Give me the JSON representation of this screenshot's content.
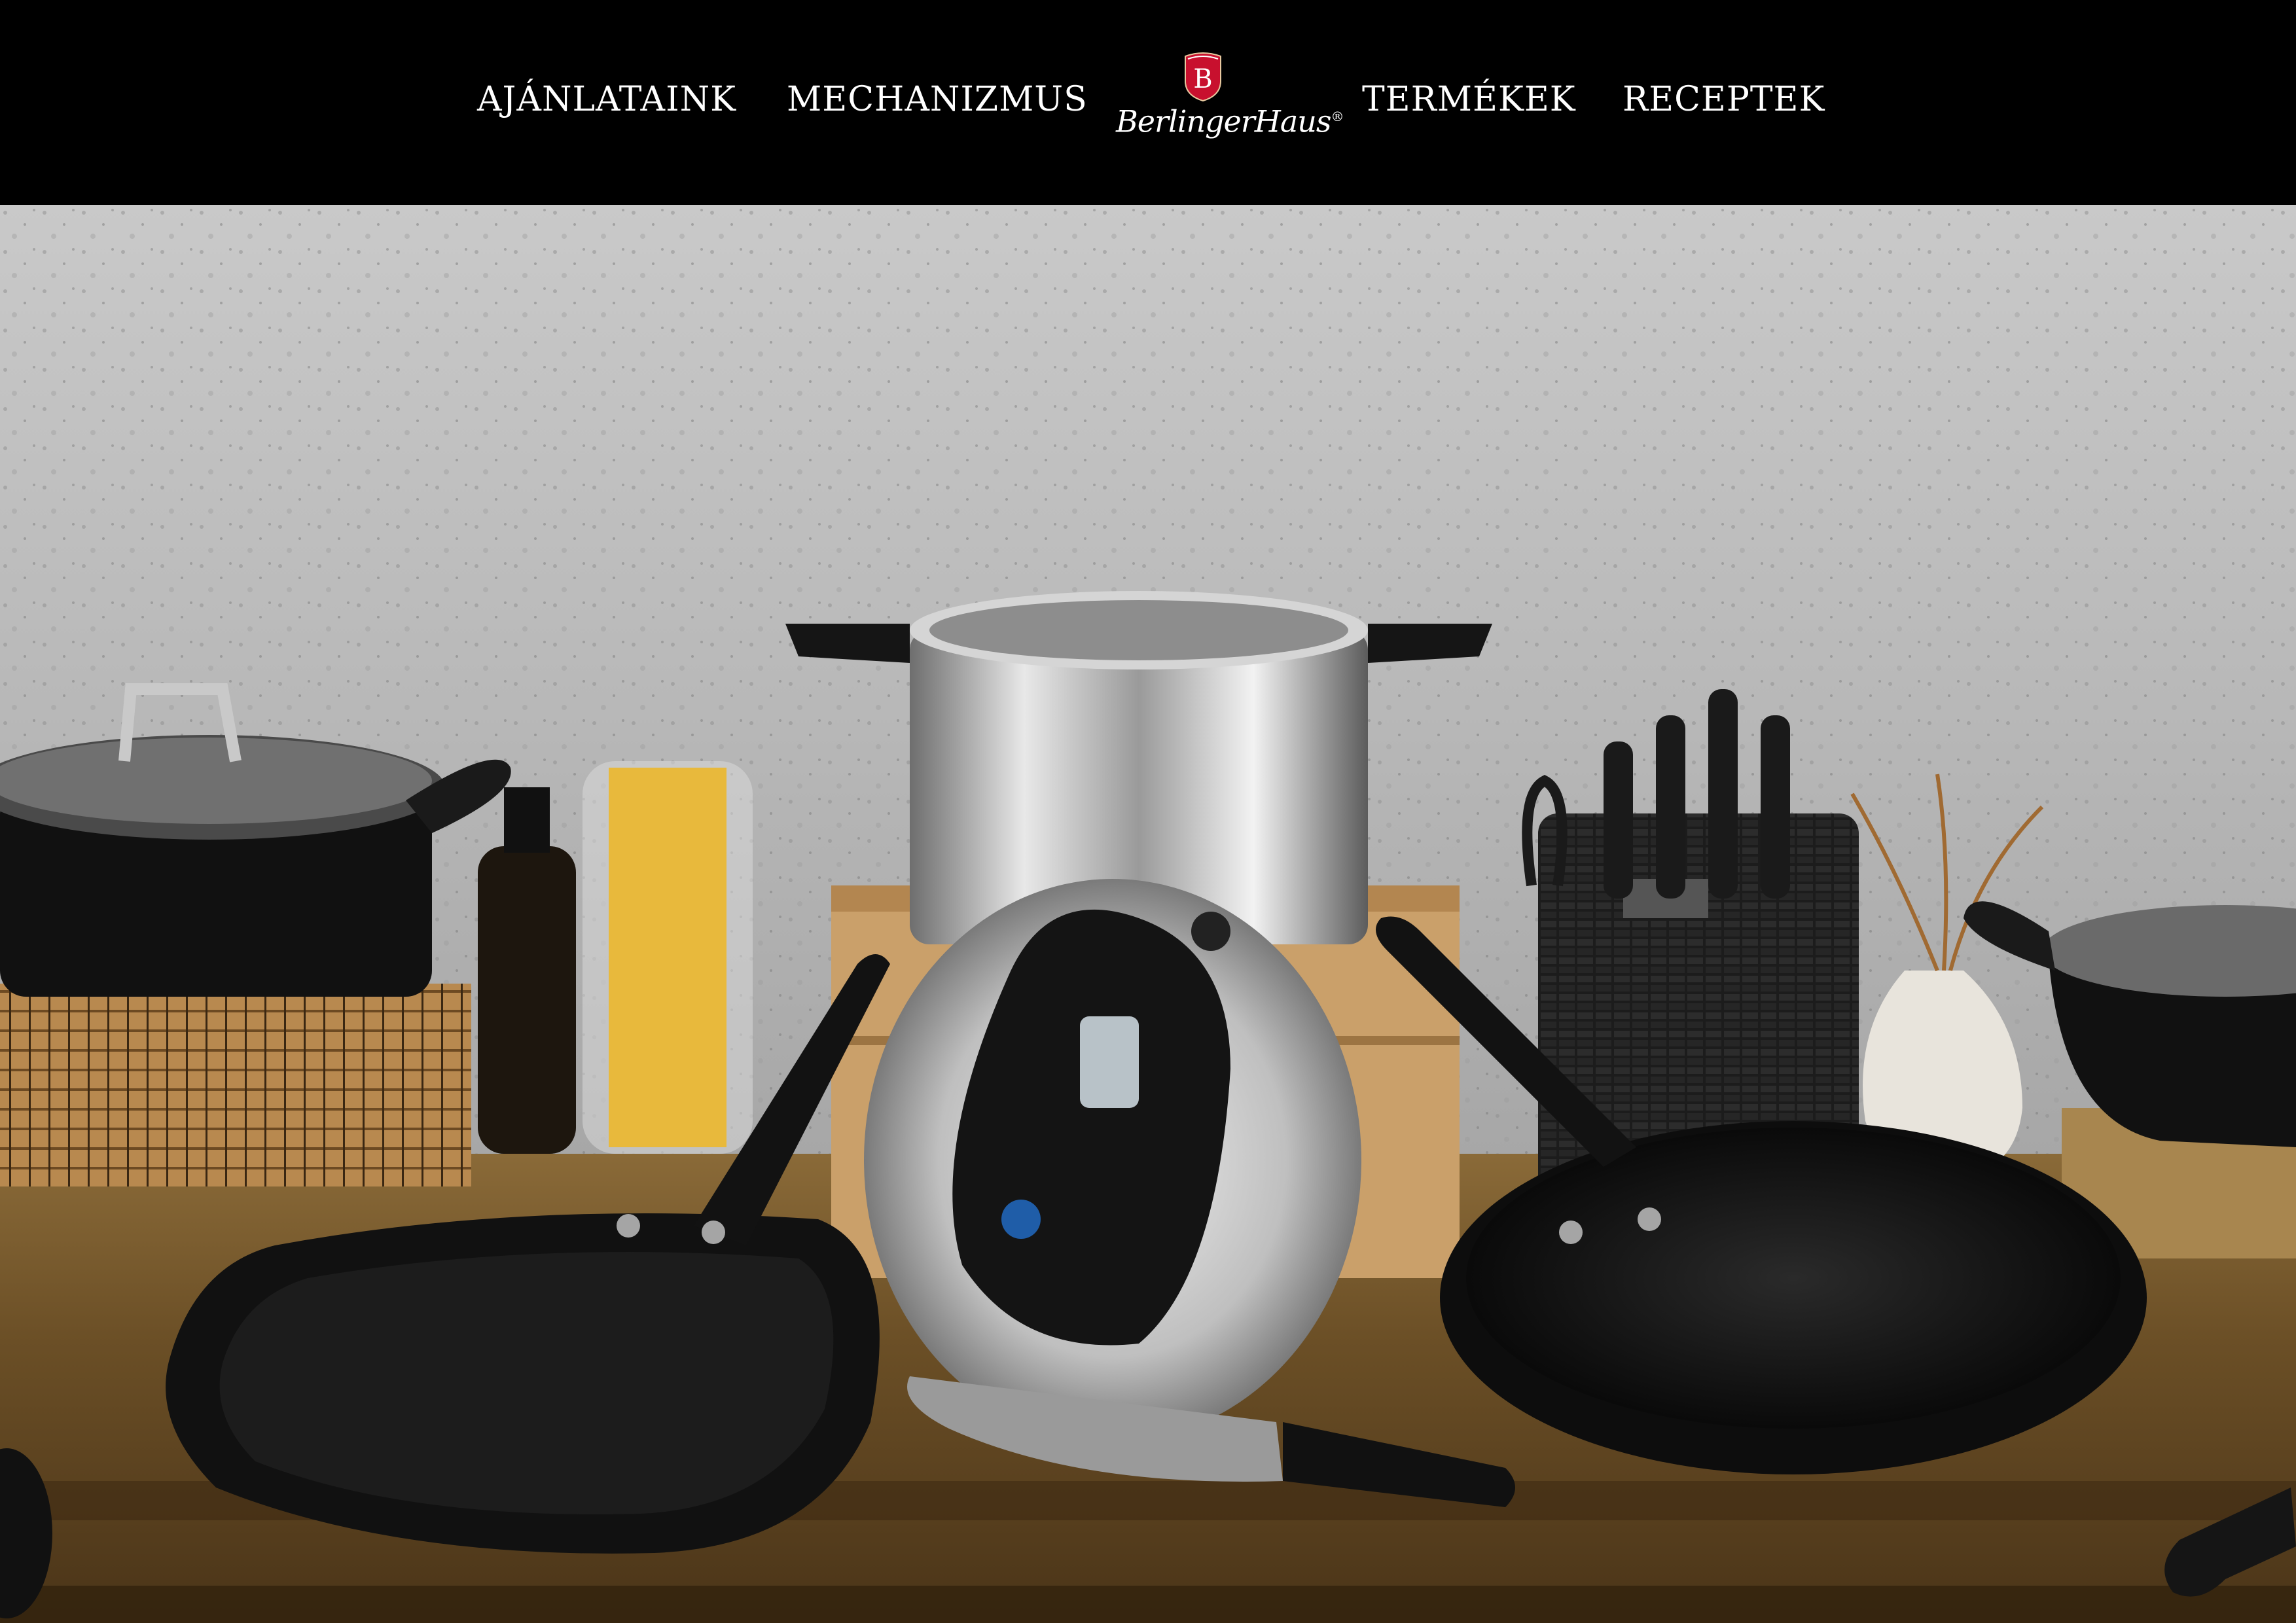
{
  "nav": {
    "items": [
      {
        "label": "AJÁNLATAINK"
      },
      {
        "label": "MECHANIZMUS"
      },
      {
        "label": "TERMÉKEK"
      },
      {
        "label": "RECEPTEK"
      }
    ]
  },
  "brand": {
    "name": "BerlingerHaus",
    "emblem_letter": "B",
    "emblem_color": "#c8102e"
  },
  "hero": {
    "image_description_icon": "cookware-set-photo"
  },
  "colors": {
    "header_bg": "#000000",
    "nav_text": "#ffffff"
  }
}
